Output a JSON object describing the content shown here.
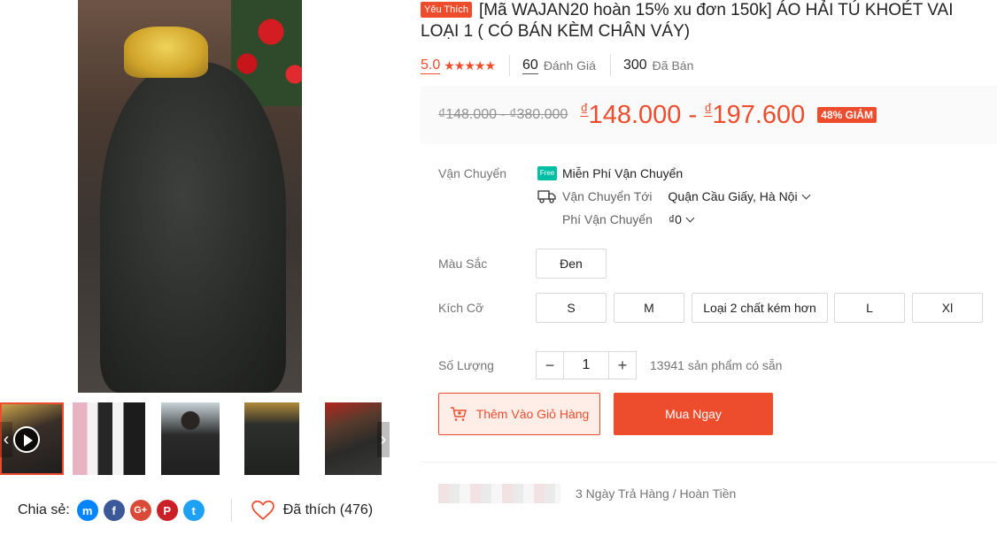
{
  "product": {
    "badge": "Yêu Thích",
    "title": "[Mã WAJAN20 hoàn 15% xu đơn 150k] ÁO HẢI TÚ KHOÉT VAI LOẠI 1 ( CÓ BÁN KÈM CHÂN VÁY)"
  },
  "rating": {
    "value": "5.0",
    "stars": "★★★★★",
    "reviews_count": "60",
    "reviews_label": "Đánh Giá",
    "sold_count": "300",
    "sold_label": "Đã Bán"
  },
  "price": {
    "old": "₫148.000 - ₫380.000",
    "currency": "₫",
    "min": "148.000",
    "separator": "-",
    "max": "197.600",
    "discount": "48% GIẢM"
  },
  "shipping": {
    "label": "Vận Chuyển",
    "free_badge": "Free",
    "free_text": "Miễn Phí Vận Chuyển",
    "to_label": "Vận Chuyển Tới",
    "to_value": "Quận Cầu Giấy, Hà Nội",
    "fee_label": "Phí Vận Chuyển",
    "fee_value": "₫0"
  },
  "color": {
    "label": "Màu Sắc",
    "options": [
      "Đen"
    ]
  },
  "size": {
    "label": "Kích Cỡ",
    "options": [
      "S",
      "M",
      "Loại 2 chất kém hơn",
      "L",
      "Xl"
    ]
  },
  "quantity": {
    "label": "Số Lượng",
    "minus": "−",
    "value": "1",
    "plus": "+",
    "stock": "13941 sản phẩm có sẵn"
  },
  "actions": {
    "add_to_cart": "Thêm Vào Giỏ Hàng",
    "buy_now": "Mua Ngay"
  },
  "guarantee": {
    "return_text": "3 Ngày Trả Hàng / Hoàn Tiền"
  },
  "share": {
    "label": "Chia sẻ:",
    "networks": [
      "messenger-icon",
      "facebook-icon",
      "google-plus-icon",
      "pinterest-icon",
      "twitter-icon"
    ],
    "fb_glyph": "f",
    "gp_glyph": "G+",
    "pin_glyph": "P",
    "msg_glyph": "m",
    "tw_glyph": "t"
  },
  "like": {
    "text": "Đã thích (476)"
  },
  "gallery": {
    "prev": "‹",
    "next": "›"
  },
  "colors": {
    "brand": "#ee4d2d",
    "free_ship": "#00bfa5"
  }
}
